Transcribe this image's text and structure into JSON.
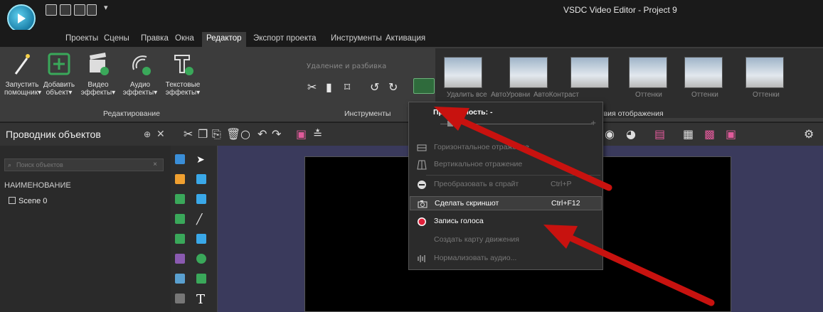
{
  "window": {
    "title": "VSDC Video Editor - Project 9"
  },
  "menu": {
    "tabs": [
      {
        "label": "Проекты"
      },
      {
        "label": "Сцены"
      },
      {
        "label": "Правка"
      },
      {
        "label": "Окна"
      },
      {
        "label": "Редактор",
        "active": true
      },
      {
        "label": "Экспорт проекта"
      },
      {
        "label": "Инструменты"
      },
      {
        "label": "Активация"
      }
    ]
  },
  "ribbon": {
    "editing": {
      "buttons": [
        {
          "label1": "Запустить",
          "label2": "помощник▾"
        },
        {
          "label1": "Добавить",
          "label2": "объект▾"
        },
        {
          "label1": "Видео",
          "label2": "эффекты▾"
        },
        {
          "label1": "Аудио",
          "label2": "эффекты▾"
        },
        {
          "label1": "Текстовые",
          "label2": "эффекты▾"
        }
      ],
      "group_label": "Редактирование"
    },
    "tools": {
      "title": "Удаление и разбивка",
      "group_label": "Инструменты"
    },
    "effects": {
      "thumbnails": [
        "Удалить все",
        "АвтоУровни",
        "АвтоКонтраст",
        "Оттенки",
        "Оттенки",
        "Оттенки"
      ],
      "group_label": "…ствия отображения"
    }
  },
  "explorer": {
    "title": "Проводник объектов",
    "pin_glyph": "⊕",
    "close_glyph": "✕",
    "search_placeholder": "Поиск объектов",
    "column_header": "НАИМЕНОВАНИЕ",
    "items": [
      {
        "label": "Scene 0"
      }
    ]
  },
  "dropdown": {
    "title": "Прозрачность: -",
    "items": [
      {
        "label": "Горизонтальное отражение",
        "enabled": false,
        "icon": "flip-horizontal-icon"
      },
      {
        "label": "Вертикальное отражение",
        "enabled": false,
        "icon": "flip-vertical-icon"
      },
      {
        "label": "Преобразовать в спрайт",
        "shortcut": "Ctrl+P",
        "enabled": false,
        "icon": "sprite-icon"
      },
      {
        "label": "Сделать скриншот",
        "shortcut": "Ctrl+F12",
        "enabled": true,
        "hover": true,
        "icon": "camera-icon"
      },
      {
        "label": "Запись голоса",
        "enabled": true,
        "icon": "record-icon"
      },
      {
        "label": "Создать карту движения",
        "enabled": false,
        "icon": ""
      },
      {
        "label": "Нормализовать аудио...",
        "enabled": false,
        "icon": "audio-normalize-icon"
      }
    ]
  },
  "colors": {
    "accent_green": "#3aa85a",
    "arrow_red": "#c8120f",
    "record_red": "#e0203a",
    "stage": "#3a3a5c"
  }
}
